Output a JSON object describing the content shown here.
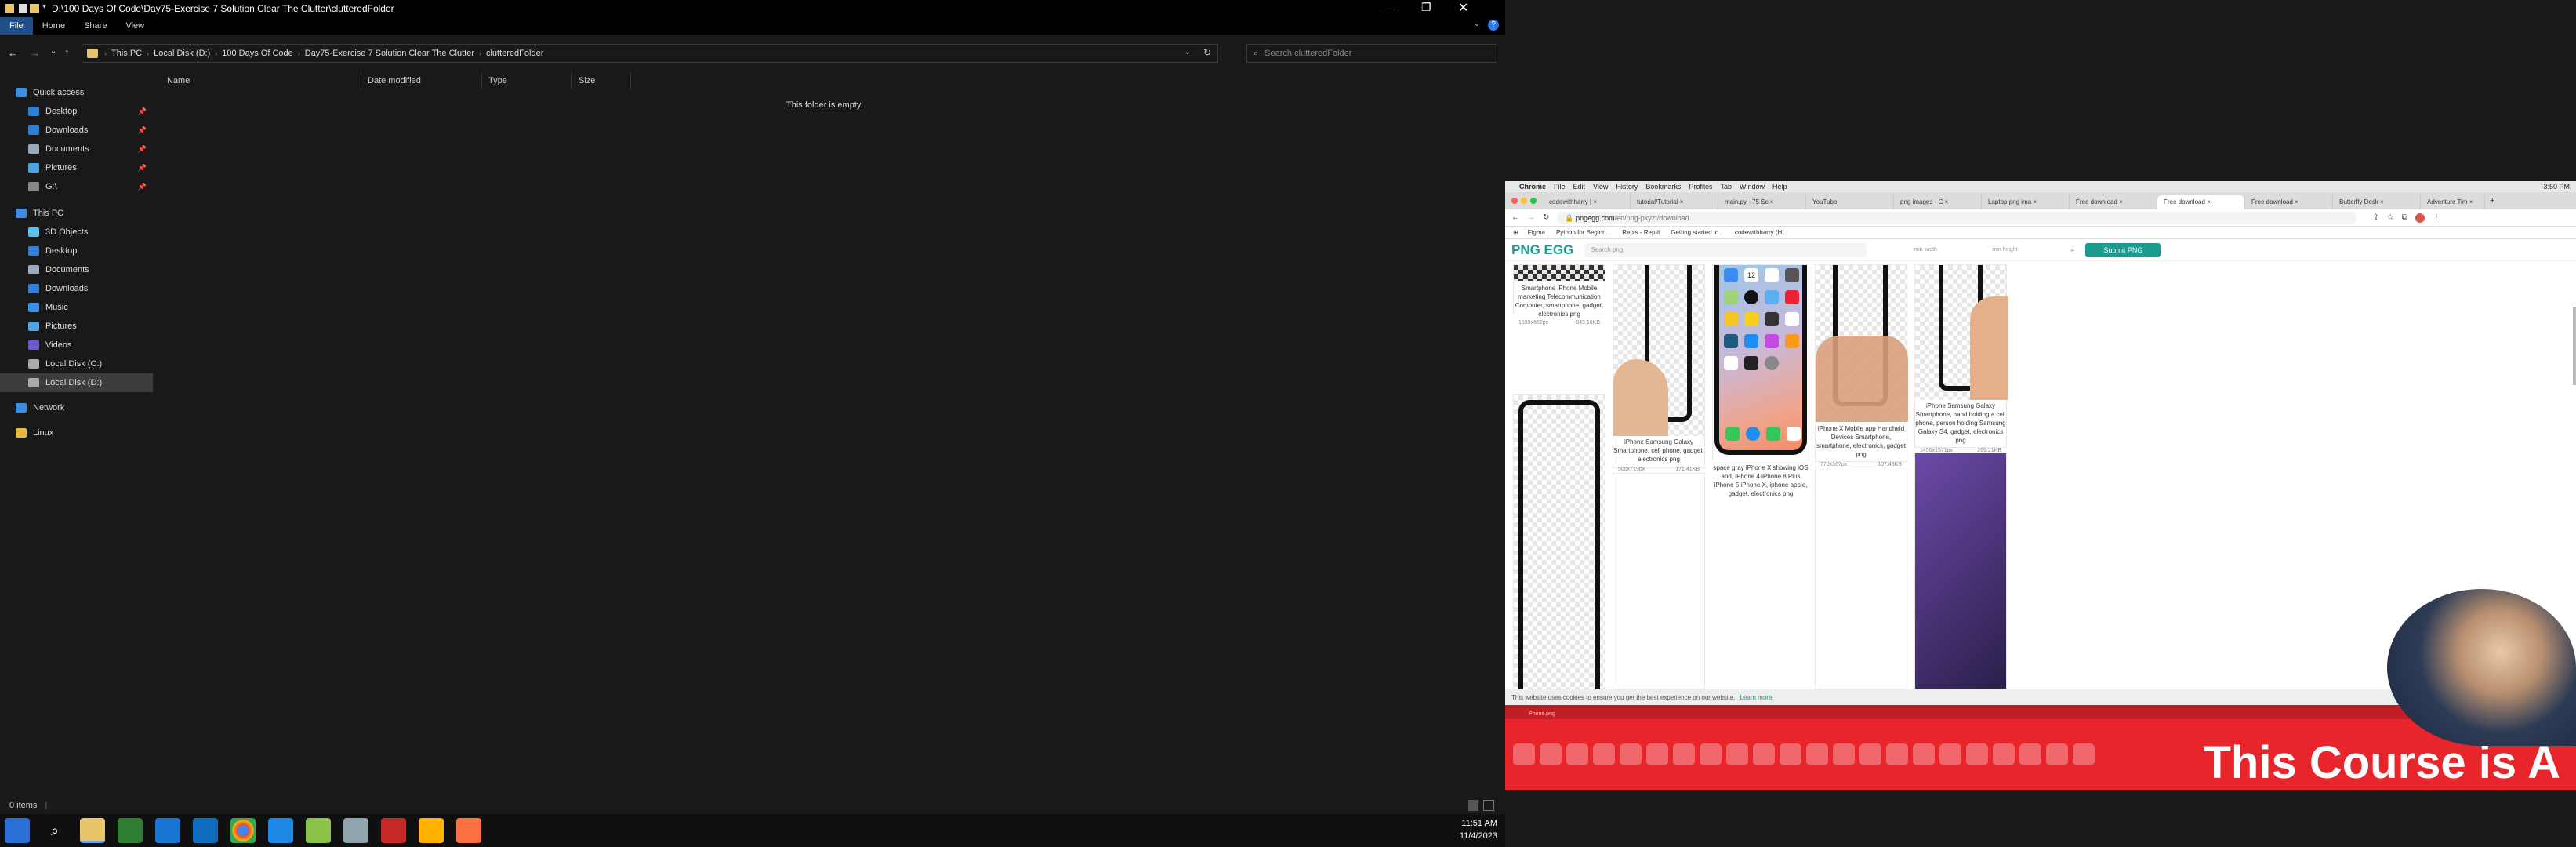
{
  "explorer": {
    "title": "D:\\100 Days Of Code\\Day75-Exercise 7 Solution Clear The Clutter\\clutteredFolder",
    "ribbon_tabs": [
      "File",
      "Home",
      "Share",
      "View"
    ],
    "breadcrumbs": [
      "This PC",
      "Local Disk (D:)",
      "100 Days Of Code",
      "Day75-Exercise 7 Solution Clear The Clutter",
      "clutteredFolder"
    ],
    "search_placeholder": "Search clutteredFolder",
    "nav": {
      "quick_access": "Quick access",
      "quick_items": [
        "Desktop",
        "Downloads",
        "Documents",
        "Pictures",
        "G:\\"
      ],
      "this_pc": "This PC",
      "pc_items": [
        "3D Objects",
        "Desktop",
        "Documents",
        "Downloads",
        "Music",
        "Pictures",
        "Videos",
        "Local Disk (C:)",
        "Local Disk (D:)"
      ],
      "network": "Network",
      "linux": "Linux"
    },
    "columns": [
      "Name",
      "Date modified",
      "Type",
      "Size"
    ],
    "empty_message": "This folder is empty.",
    "status": "0 items",
    "clock_time": "11:51 AM",
    "clock_date": "11/4/2023"
  },
  "browser": {
    "menu": [
      "Chrome",
      "File",
      "Edit",
      "View",
      "History",
      "Bookmarks",
      "Profiles",
      "Tab",
      "Window",
      "Help"
    ],
    "mac_time": "3:50 PM",
    "tabs": [
      "codewithharry | ×",
      "tutorial/Tutorial ×",
      "main.py - 75 Sc ×",
      "YouTube",
      "png images - C ×",
      "Laptop png ima ×",
      "Free download ×",
      "Free download ×",
      "Free download ×",
      "Butterfly Desk ×",
      "Adventure Tim ×"
    ],
    "url_domain": "pngegg.com",
    "url_path": "/en/png-pkyzt/download",
    "bookmarks": [
      "Figma",
      "Python for Beginn...",
      "Repls - Replit",
      "Getting started in...",
      "codewithharry (H..."
    ],
    "site": {
      "logo": "PNG EGG",
      "search_placeholder": "Search png",
      "min_width": "min width",
      "min_height": "min height",
      "submit": "Submit PNG"
    },
    "cards": [
      {
        "caption": "Smartphone iPhone Mobile marketing Telecommunication Computer, smartphone, gadget, electronics png",
        "dims": "1599x652px",
        "size": "849.16KB"
      },
      {
        "caption": "iPhone Samsung Galaxy Smartphone, cell phone, gadget, electronics png",
        "dims": "500x719px",
        "size": "171.41KB"
      },
      {
        "caption": "space gray iPhone X showing iOS and, iPhone 4 iPhone 8 Plus iPhone 5 iPhone X, iphone apple, gadget, electronics png",
        "dims": "",
        "size": ""
      },
      {
        "caption": "iPhone X Mobile app Handheld Devices Smartphone, smartphone, electronics, gadget png",
        "dims": "770x367px",
        "size": "107.48KB"
      },
      {
        "caption": "iPhone Samsung Galaxy Smartphone, hand holding a cell phone, person holding Samsung Galaxy S4, gadget, electronics png",
        "dims": "1456x1571px",
        "size": "269.21KB"
      }
    ],
    "iphone_date": "12",
    "cookie_text": "This website uses cookies to ensure you get the best experience on our website.",
    "cookie_link": "Learn more",
    "dock_label": "Phone.png",
    "banner": "This Course is A"
  }
}
